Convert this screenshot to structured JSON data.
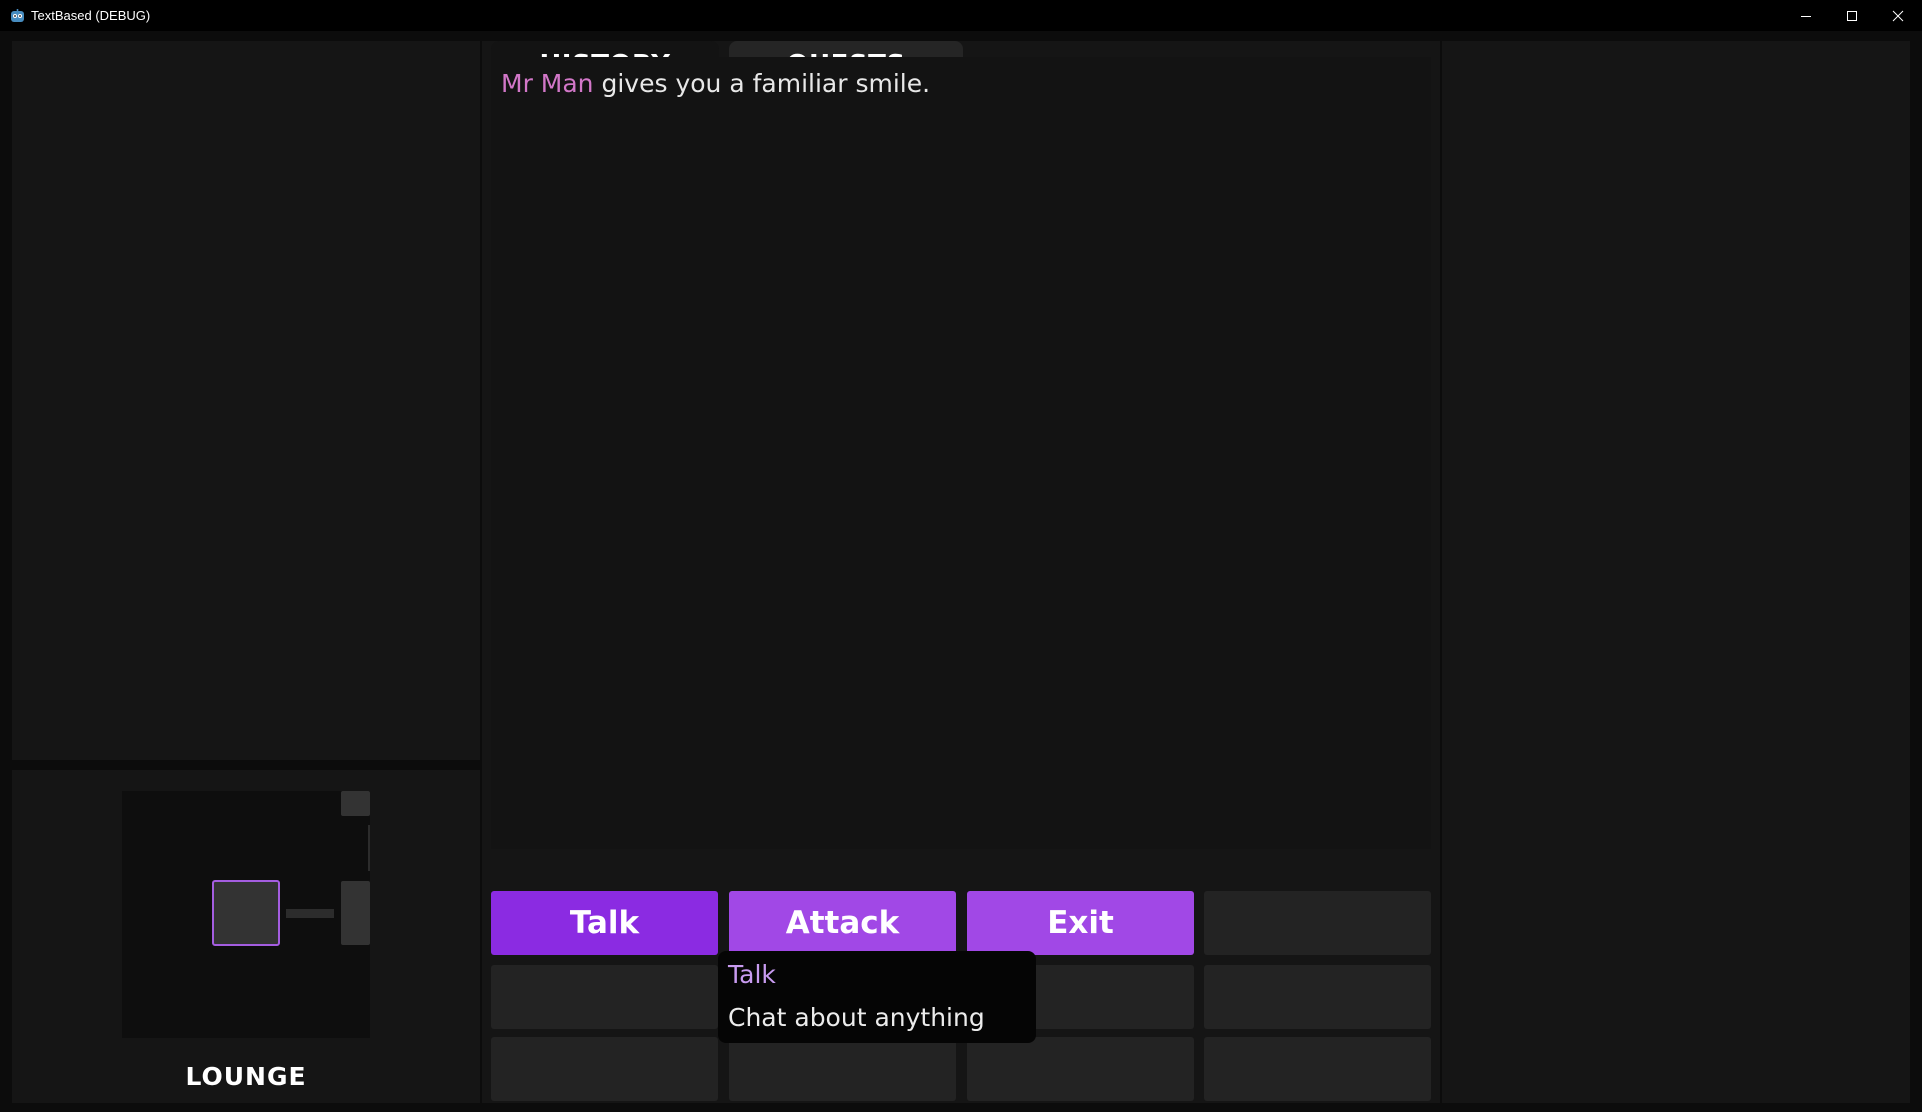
{
  "window": {
    "title": "TextBased (DEBUG)",
    "icon": "godot-engine-icon",
    "minimize_icon": "minimize-icon",
    "maximize_icon": "maximize-icon",
    "close_icon": "close-icon"
  },
  "tabs": [
    {
      "label": "HISTORY",
      "active": true
    },
    {
      "label": "QUESTS",
      "active": false
    }
  ],
  "history": {
    "entries": [
      {
        "speaker": "Mr Man",
        "text": " gives you a familiar smile."
      }
    ]
  },
  "actions": [
    {
      "label": "Talk",
      "color": "#8b2be2"
    },
    {
      "label": "Attack",
      "color": "#a148e6"
    },
    {
      "label": "Exit",
      "color": "#a148e6"
    }
  ],
  "tooltip": {
    "title": "Talk",
    "description": "Chat about anything"
  },
  "minimap": {
    "location": "LOUNGE",
    "current_room_color": "#a45de0"
  },
  "colors": {
    "background": "#0c0c0c",
    "panel": "#151515",
    "accent": "#8b2be2",
    "npc_name": "#d277c8"
  }
}
